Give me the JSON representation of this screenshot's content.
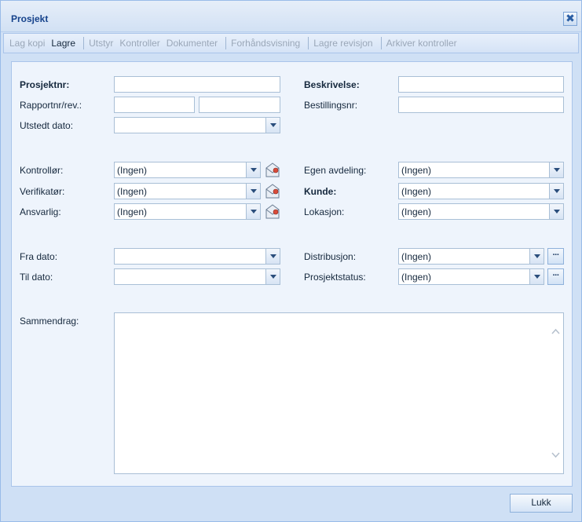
{
  "window": {
    "title": "Prosjekt",
    "close_glyph": "✖",
    "close_icon": "close-icon"
  },
  "toolbar": {
    "items": [
      {
        "label": "Lag kopi",
        "enabled": false
      },
      {
        "label": "Lagre",
        "enabled": true
      },
      {
        "label": "Utstyr",
        "enabled": false
      },
      {
        "label": "Kontroller",
        "enabled": false
      },
      {
        "label": "Dokumenter",
        "enabled": false
      },
      {
        "label": "Forhåndsvisning",
        "enabled": false
      },
      {
        "label": "Lagre revisjon",
        "enabled": false
      },
      {
        "label": "Arkiver kontroller",
        "enabled": false
      }
    ]
  },
  "form": {
    "prosjektnr": {
      "label": "Prosjektnr:",
      "value": ""
    },
    "rapportnr": {
      "label": "Rapportnr/rev.:",
      "value": "",
      "rev_value": ""
    },
    "utstedt_dato": {
      "label": "Utstedt dato:",
      "value": ""
    },
    "beskrivelse": {
      "label": "Beskrivelse:",
      "value": ""
    },
    "bestillingsnr": {
      "label": "Bestillingsnr:",
      "value": ""
    },
    "kontrollor": {
      "label": "Kontrollør:",
      "value": "(Ingen)"
    },
    "verifikator": {
      "label": "Verifikatør:",
      "value": "(Ingen)"
    },
    "ansvarlig": {
      "label": "Ansvarlig:",
      "value": "(Ingen)"
    },
    "egen_avdeling": {
      "label": "Egen avdeling:",
      "value": "(Ingen)"
    },
    "kunde": {
      "label": "Kunde:",
      "value": "(Ingen)"
    },
    "lokasjon": {
      "label": "Lokasjon:",
      "value": "(Ingen)"
    },
    "fra_dato": {
      "label": "Fra dato:",
      "value": ""
    },
    "til_dato": {
      "label": "Til dato:",
      "value": ""
    },
    "distribusjon": {
      "label": "Distribusjon:",
      "value": "(Ingen)",
      "more_glyph": "···"
    },
    "prosjektstatus": {
      "label": "Prosjektstatus:",
      "value": "(Ingen)",
      "more_glyph": "···"
    },
    "sammendrag": {
      "label": "Sammendrag:",
      "value": ""
    }
  },
  "footer": {
    "close_label": "Lukk"
  },
  "icons": {
    "person_lookup": "person-lookup-icon",
    "scroll_up": "chevron-up-icon",
    "scroll_down": "chevron-down-icon"
  },
  "colors": {
    "window_bg": "#cfe0f5",
    "panel_bg": "#eef4fc",
    "title_text": "#15428b",
    "border": "#99bbe8"
  }
}
